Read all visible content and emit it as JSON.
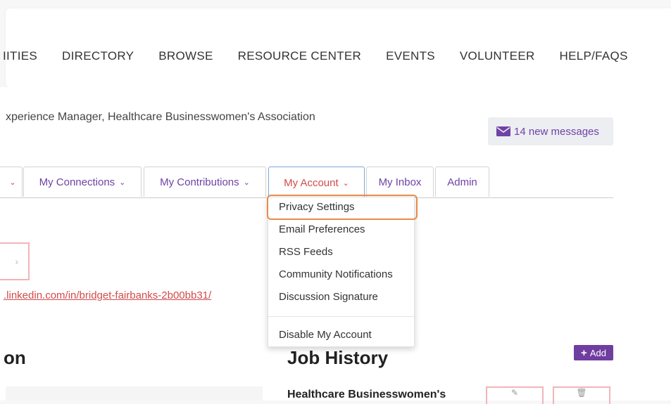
{
  "topnav": {
    "items": [
      "IITIES",
      "DIRECTORY",
      "BROWSE",
      "RESOURCE CENTER",
      "EVENTS",
      "VOLUNTEER",
      "HELP/FAQS"
    ]
  },
  "profile": {
    "subtitle": "xperience Manager, Healthcare Businesswomen's Association",
    "linkedin_url": ".linkedin.com/in/bridget-fairbanks-2b00bb31/"
  },
  "messages": {
    "label": "14 new messages",
    "icon": "envelope-icon"
  },
  "tabs": [
    {
      "label": "My Connections"
    },
    {
      "label": "My Contributions"
    },
    {
      "label": "My Account"
    },
    {
      "label": "My Inbox"
    },
    {
      "label": "Admin"
    }
  ],
  "account_menu": {
    "items": [
      "Privacy Settings",
      "Email Preferences",
      "RSS Feeds",
      "Community Notifications",
      "Discussion Signature",
      "Disable My Account"
    ]
  },
  "sections": {
    "left_heading": "on",
    "job_history_heading": "Job History",
    "add_label": "Add",
    "job_org": "Healthcare Businesswomen's"
  },
  "colors": {
    "accent_purple": "#6f42a6",
    "active_red": "#d24b4b",
    "highlight_orange": "#e88b4b"
  }
}
